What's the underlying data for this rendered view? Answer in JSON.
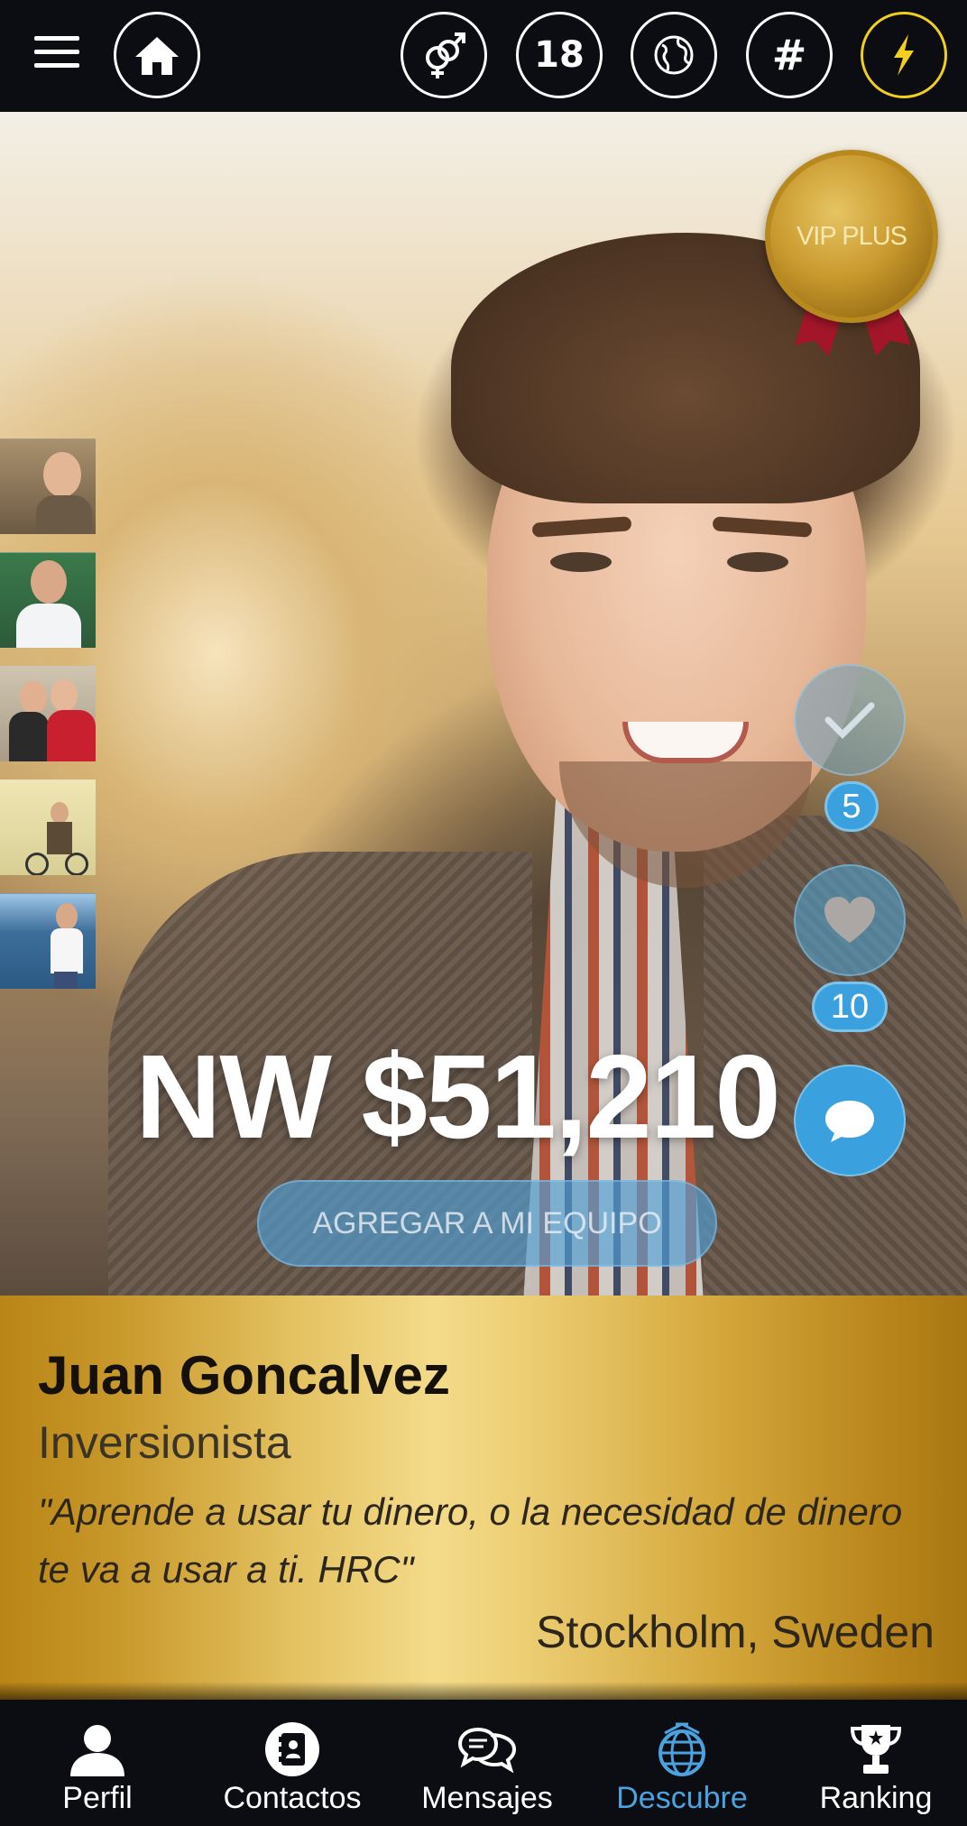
{
  "topbar": {
    "age_label": "18",
    "hashtag_label": "#",
    "icons": [
      "menu-icon",
      "home-icon",
      "gender-icon",
      "age-filter",
      "globe-icon",
      "hashtag-icon",
      "lightning-icon"
    ],
    "accent_color": "#f2cf1e"
  },
  "profile": {
    "badge": "VIP PLUS",
    "net_worth": "NW $51,210",
    "add_button": "AGREGAR A MI EQUIPO",
    "name": "Juan Goncalvez",
    "role": "Inversionista",
    "quote": "\"Aprende a usar tu dinero, o la necesidad de dinero te va a usar a ti. HRC\"",
    "location": "Stockholm, Sweden"
  },
  "actions": {
    "checks_count": "5",
    "likes_count": "10",
    "icons": [
      "check-icon",
      "heart-icon",
      "chat-icon"
    ]
  },
  "nav": {
    "items": [
      {
        "label": "Perfil",
        "icon": "person-icon"
      },
      {
        "label": "Contactos",
        "icon": "contacts-icon"
      },
      {
        "label": "Mensajes",
        "icon": "messages-icon"
      },
      {
        "label": "Descubre",
        "icon": "globe-icon"
      },
      {
        "label": "Ranking",
        "icon": "trophy-icon"
      }
    ],
    "active": "Descubre",
    "active_color": "#4aa3df"
  }
}
